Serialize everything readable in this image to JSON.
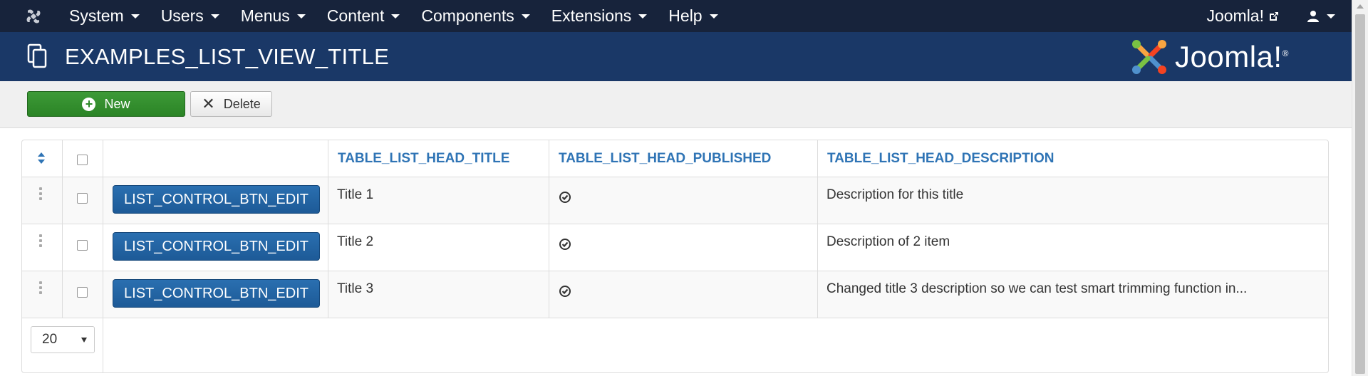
{
  "topbar": {
    "menu": [
      {
        "label": "System"
      },
      {
        "label": "Users"
      },
      {
        "label": "Menus"
      },
      {
        "label": "Content"
      },
      {
        "label": "Components"
      },
      {
        "label": "Extensions"
      },
      {
        "label": "Help"
      }
    ],
    "site_link": "Joomla!",
    "user_icon": "user-icon"
  },
  "header": {
    "title": "EXAMPLES_LIST_VIEW_TITLE",
    "brand_text": "Joomla!",
    "brand_reg": "®"
  },
  "toolbar": {
    "new_label": "New",
    "delete_label": "Delete"
  },
  "table": {
    "headers": {
      "title": "TABLE_LIST_HEAD_TITLE",
      "published": "TABLE_LIST_HEAD_PUBLISHED",
      "description": "TABLE_LIST_HEAD_DESCRIPTION"
    },
    "rows": [
      {
        "edit_label": "LIST_CONTROL_BTN_EDIT",
        "title": "Title 1",
        "published": true,
        "description": "Description for this title"
      },
      {
        "edit_label": "LIST_CONTROL_BTN_EDIT",
        "title": "Title 2",
        "published": true,
        "description": "Description of 2 item"
      },
      {
        "edit_label": "LIST_CONTROL_BTN_EDIT",
        "title": "Title 3",
        "published": true,
        "description": "Changed title 3 description so we can test smart trimming function in..."
      }
    ]
  },
  "pagination": {
    "limit_value": "20"
  },
  "colors": {
    "topbar_bg": "#17233b",
    "header_bg": "#1a3867",
    "new_button": "#2f8a2a",
    "edit_button": "#2166a6",
    "head_link": "#2f74b5"
  }
}
